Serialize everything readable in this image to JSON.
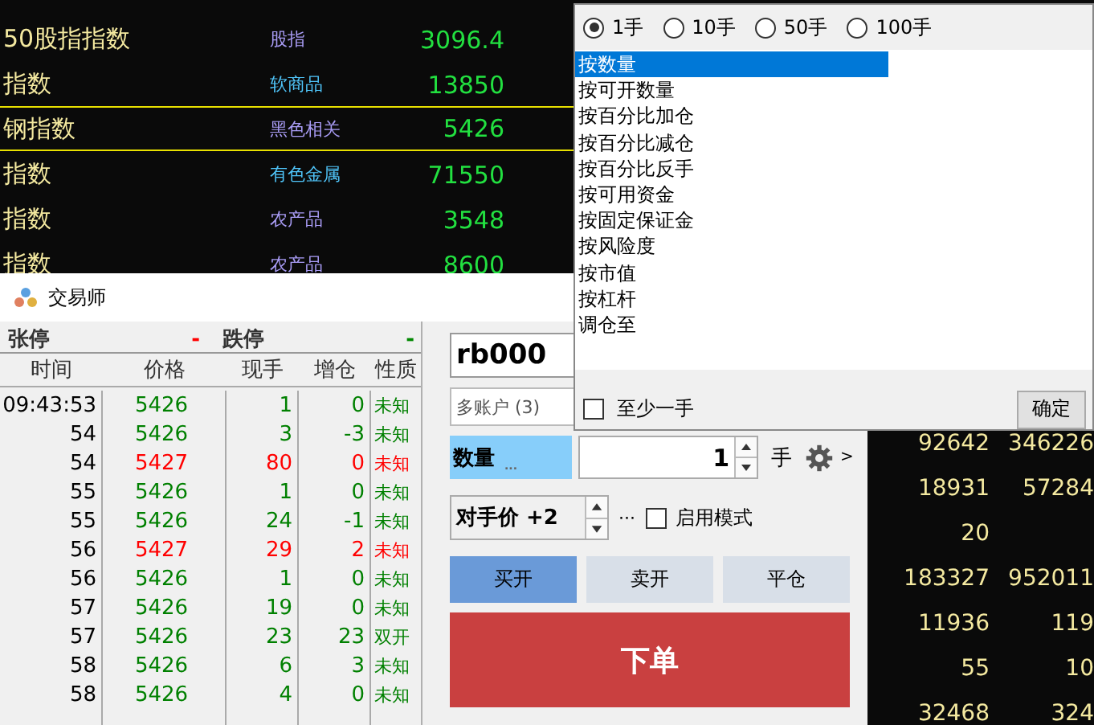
{
  "market_rows": [
    {
      "name": "50股指指数",
      "category": "股指",
      "color": "#a99cf5",
      "price": "3096.4",
      "selected": false
    },
    {
      "name": "指数",
      "category": "软商品",
      "color": "#4fc3f7",
      "price": "13850",
      "selected": false
    },
    {
      "name": "钢指数",
      "category": "黑色相关",
      "color": "#a99cf5",
      "price": "5426",
      "selected": true
    },
    {
      "name": "指数",
      "category": "有色金属",
      "color": "#4fc3f7",
      "price": "71550",
      "selected": false
    },
    {
      "name": "指数",
      "category": "农产品",
      "color": "#a99cf5",
      "price": "3548",
      "selected": false
    },
    {
      "name": "指数",
      "category": "农产品",
      "color": "#a99cf5",
      "price": "8600",
      "selected": false
    }
  ],
  "market_volumes": [
    {
      "volume": "92642",
      "open_interest": "346226"
    },
    {
      "volume": "18931",
      "open_interest": "57284"
    },
    {
      "volume": "20"
    },
    {
      "volume": "183327",
      "open_interest": "952011"
    },
    {
      "volume": "11936",
      "open_interest": "119"
    },
    {
      "volume": "55",
      "open_interest": "10"
    },
    {
      "volume": "32468",
      "open_interest": "324"
    }
  ],
  "trade_window": {
    "title": "交易师",
    "limit_up_label": "张停",
    "limit_up": "-",
    "limit_down_label": "跌停",
    "limit_down": "-",
    "columns": [
      "时间",
      "价格",
      "现手",
      "增仓",
      "性质"
    ],
    "ticks": [
      {
        "time": "09:43:53",
        "price": "5426",
        "volume": "1",
        "change": "0",
        "nature": "未知",
        "color": "#008000"
      },
      {
        "time": "54",
        "price": "5426",
        "volume": "3",
        "change": "-3",
        "nature": "未知",
        "color": "#008000"
      },
      {
        "time": "54",
        "price": "5427",
        "volume": "80",
        "change": "0",
        "nature": "未知",
        "color": "#ff0000"
      },
      {
        "time": "55",
        "price": "5426",
        "volume": "1",
        "change": "0",
        "nature": "未知",
        "color": "#008000"
      },
      {
        "time": "55",
        "price": "5426",
        "volume": "24",
        "change": "-1",
        "nature": "未知",
        "color": "#008000"
      },
      {
        "time": "56",
        "price": "5427",
        "volume": "29",
        "change": "2",
        "nature": "未知",
        "color": "#ff0000"
      },
      {
        "time": "56",
        "price": "5426",
        "volume": "1",
        "change": "0",
        "nature": "未知",
        "color": "#008000"
      },
      {
        "time": "57",
        "price": "5426",
        "volume": "19",
        "change": "0",
        "nature": "未知",
        "color": "#008000"
      },
      {
        "time": "57",
        "price": "5426",
        "volume": "23",
        "change": "23",
        "nature": "双开",
        "color": "#008000"
      },
      {
        "time": "58",
        "price": "5426",
        "volume": "6",
        "change": "3",
        "nature": "未知",
        "color": "#008000"
      },
      {
        "time": "58",
        "price": "5426",
        "volume": "4",
        "change": "0",
        "nature": "未知",
        "color": "#008000"
      }
    ],
    "symbol": "rb000",
    "account": "多账户 (3)",
    "quantity_label": "数量",
    "quantity_more": "...",
    "quantity": "1",
    "quantity_unit": "手",
    "settings_more": ">",
    "price_mode": "对手价 +2",
    "price_more": "···",
    "enable_mode": {
      "label": "启用模式",
      "checked": false
    },
    "sides": [
      {
        "label": "买开",
        "selected": true
      },
      {
        "label": "卖开",
        "selected": false
      },
      {
        "label": "平仓",
        "selected": false
      }
    ],
    "submit": "下单"
  },
  "quantity_popup": {
    "lots": [
      {
        "label": "1手",
        "selected": true
      },
      {
        "label": "10手",
        "selected": false
      },
      {
        "label": "50手",
        "selected": false
      },
      {
        "label": "100手",
        "selected": false
      }
    ],
    "methods": [
      {
        "label": "按数量",
        "selected": true
      },
      {
        "label": "按可开数量",
        "selected": false
      },
      {
        "label": "按百分比加仓",
        "selected": false
      },
      {
        "label": "按百分比减仓",
        "selected": false
      },
      {
        "label": "按百分比反手",
        "selected": false
      },
      {
        "label": "按可用资金",
        "selected": false
      },
      {
        "label": "按固定保证金",
        "selected": false
      },
      {
        "label": "按风险度",
        "selected": false
      },
      {
        "label": "按市值",
        "selected": false
      },
      {
        "label": "按杠杆",
        "selected": false
      },
      {
        "label": "调仓至",
        "selected": false
      }
    ],
    "at_least_one": {
      "label": "至少一手",
      "checked": false
    },
    "confirm": "确定"
  }
}
